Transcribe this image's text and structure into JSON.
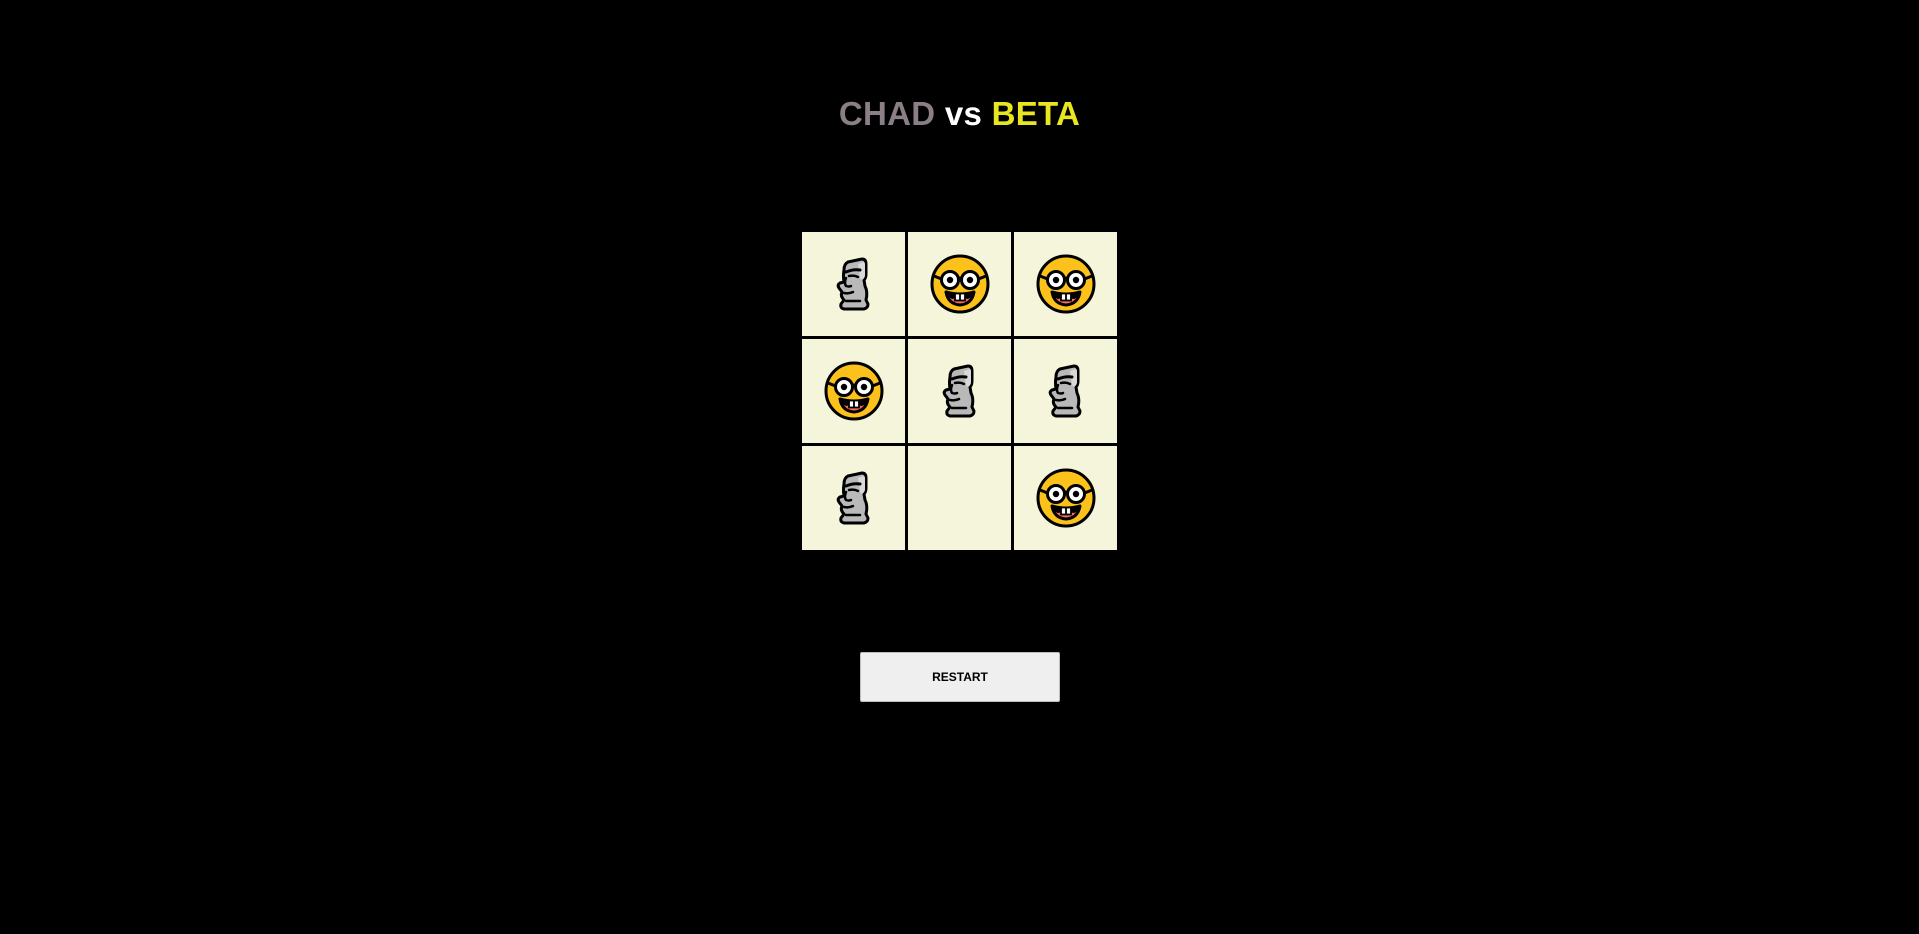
{
  "title": {
    "player_one": "CHAD",
    "separator": "vs",
    "player_two": "BETA",
    "colors": {
      "player_one": "#8a7f86",
      "separator": "#ffffff",
      "player_two": "#e8e620"
    }
  },
  "board": {
    "cell_color": "#f5f5dc",
    "pieces_legend": {
      "moai": "moai-icon",
      "nerd": "nerd-face-icon"
    },
    "cells": [
      {
        "row": 1,
        "col": 1,
        "piece": "moai"
      },
      {
        "row": 1,
        "col": 2,
        "piece": "nerd"
      },
      {
        "row": 1,
        "col": 3,
        "piece": "nerd"
      },
      {
        "row": 2,
        "col": 1,
        "piece": "nerd"
      },
      {
        "row": 2,
        "col": 2,
        "piece": "moai"
      },
      {
        "row": 2,
        "col": 3,
        "piece": "moai"
      },
      {
        "row": 3,
        "col": 1,
        "piece": "moai"
      },
      {
        "row": 3,
        "col": 2,
        "piece": ""
      },
      {
        "row": 3,
        "col": 3,
        "piece": "nerd"
      }
    ]
  },
  "controls": {
    "restart_label": "RESTART"
  }
}
